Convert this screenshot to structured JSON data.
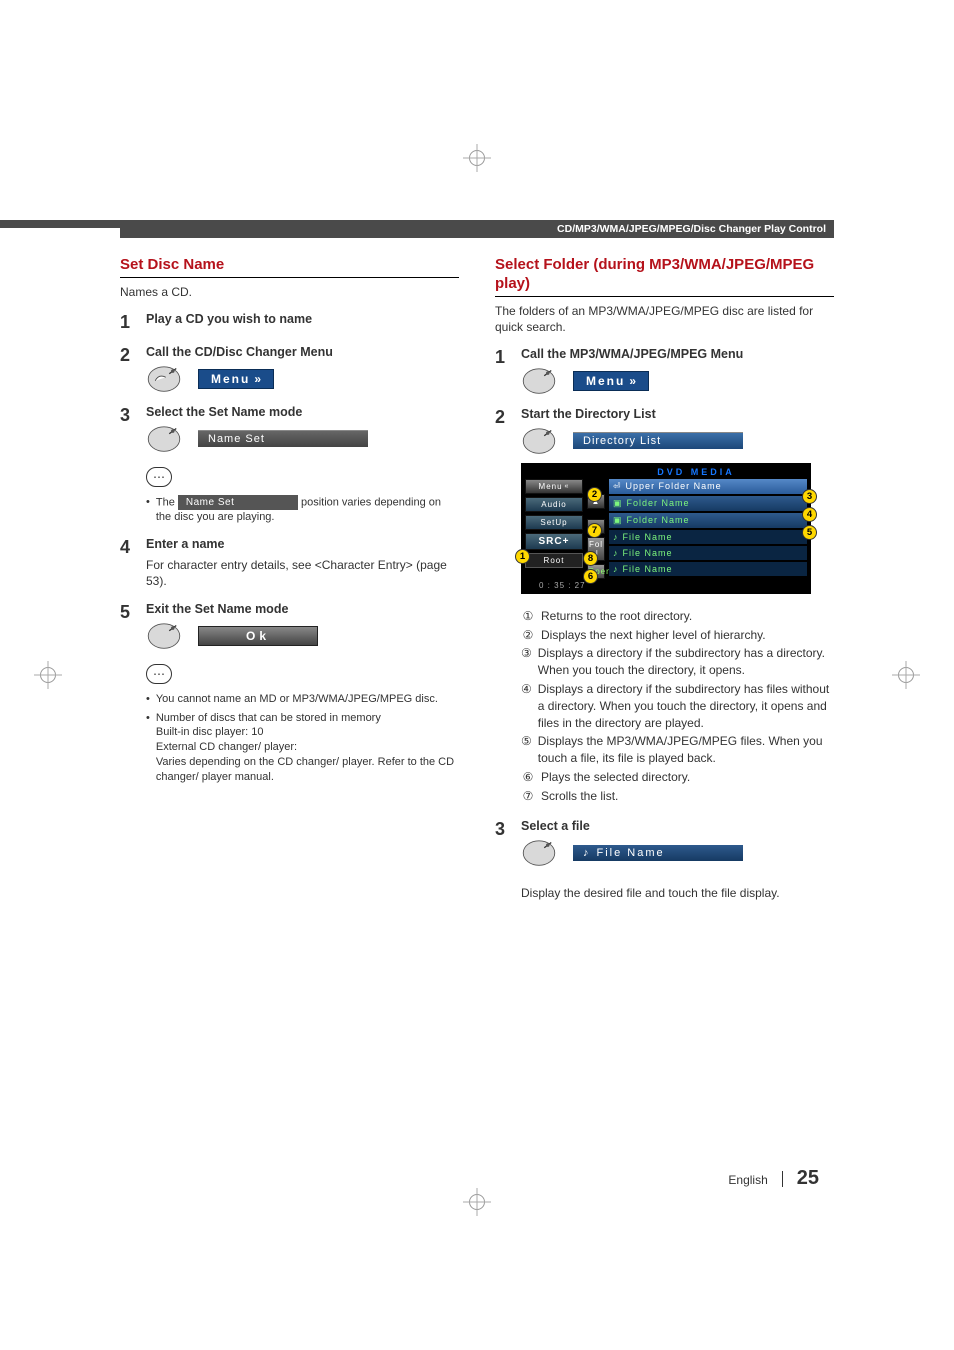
{
  "header": {
    "category": "CD/MP3/WMA/JPEG/MPEG/Disc Changer Play Control"
  },
  "left": {
    "title": "Set Disc Name",
    "lead": "Names a CD.",
    "s1": {
      "num": "1",
      "title": "Play a CD you wish to name"
    },
    "s2": {
      "num": "2",
      "title": "Call the CD/Disc Changer Menu",
      "btn": "Menu"
    },
    "s3": {
      "num": "3",
      "title": "Select the Set Name mode",
      "btn": "Name Set"
    },
    "note1_pre": "The",
    "note1_btn": "Name Set",
    "note1_post": "position varies depending on the disc you are playing.",
    "s4": {
      "num": "4",
      "title": "Enter a name",
      "desc": "For character entry details, see <Character Entry> (page 53)."
    },
    "s5": {
      "num": "5",
      "title": "Exit the Set Name mode",
      "btn": "Ok"
    },
    "note2_b1": "You cannot name an MD or MP3/WMA/JPEG/MPEG disc.",
    "note2_b2": "Number of discs that can be stored in memory",
    "note2_b2a": "Built-in disc player: 10",
    "note2_b2b": "External CD changer/ player:",
    "note2_b2c": "Varies depending on the CD changer/ player. Refer to the CD changer/ player manual."
  },
  "right": {
    "title": "Select Folder (during MP3/WMA/JPEG/MPEG play)",
    "lead": "The folders of an MP3/WMA/JPEG/MPEG disc are listed for quick search.",
    "s1": {
      "num": "1",
      "title": "Call the MP3/WMA/JPEG/MPEG Menu",
      "btn": "Menu"
    },
    "s2": {
      "num": "2",
      "title": "Start the Directory List",
      "btn": "Directory List"
    },
    "scr": {
      "title": "DVD MEDIA",
      "tabs": {
        "audio": "Audio",
        "setup": "SetUp",
        "src": "SRC+",
        "root": "Root",
        "menu": "Menu",
        "arr_up": "▲",
        "arr_dn": "▼",
        "fol": "Fol ↲",
        "open": "Open"
      },
      "upper": "Upper Folder Name",
      "folder1": "Folder Name",
      "folder2": "Folder Name",
      "file1": "File Name",
      "file2": "File Name",
      "file3": "File Name",
      "time": "0 : 35 : 27"
    },
    "callouts": {
      "c1": {
        "n": "①",
        "t": "Returns to the root directory."
      },
      "c2": {
        "n": "②",
        "t": "Displays the next higher level of hierarchy."
      },
      "c3": {
        "n": "③",
        "t": "Displays a directory if the subdirectory has a directory. When you touch the directory, it opens."
      },
      "c4": {
        "n": "④",
        "t": "Displays a directory if the subdirectory has files without a directory. When you touch the directory, it opens and files in the directory are played."
      },
      "c5": {
        "n": "⑤",
        "t": "Displays the MP3/WMA/JPEG/MPEG files. When you touch a file, its file is played back."
      },
      "c6": {
        "n": "⑥",
        "t": "Plays the selected directory."
      },
      "c7": {
        "n": "⑦",
        "t": "Scrolls the list."
      }
    },
    "s3": {
      "num": "3",
      "title": "Select a file",
      "btn": "File Name",
      "desc": "Display the desired file and touch the file display."
    }
  },
  "footer": {
    "lang": "English",
    "page": "25"
  }
}
